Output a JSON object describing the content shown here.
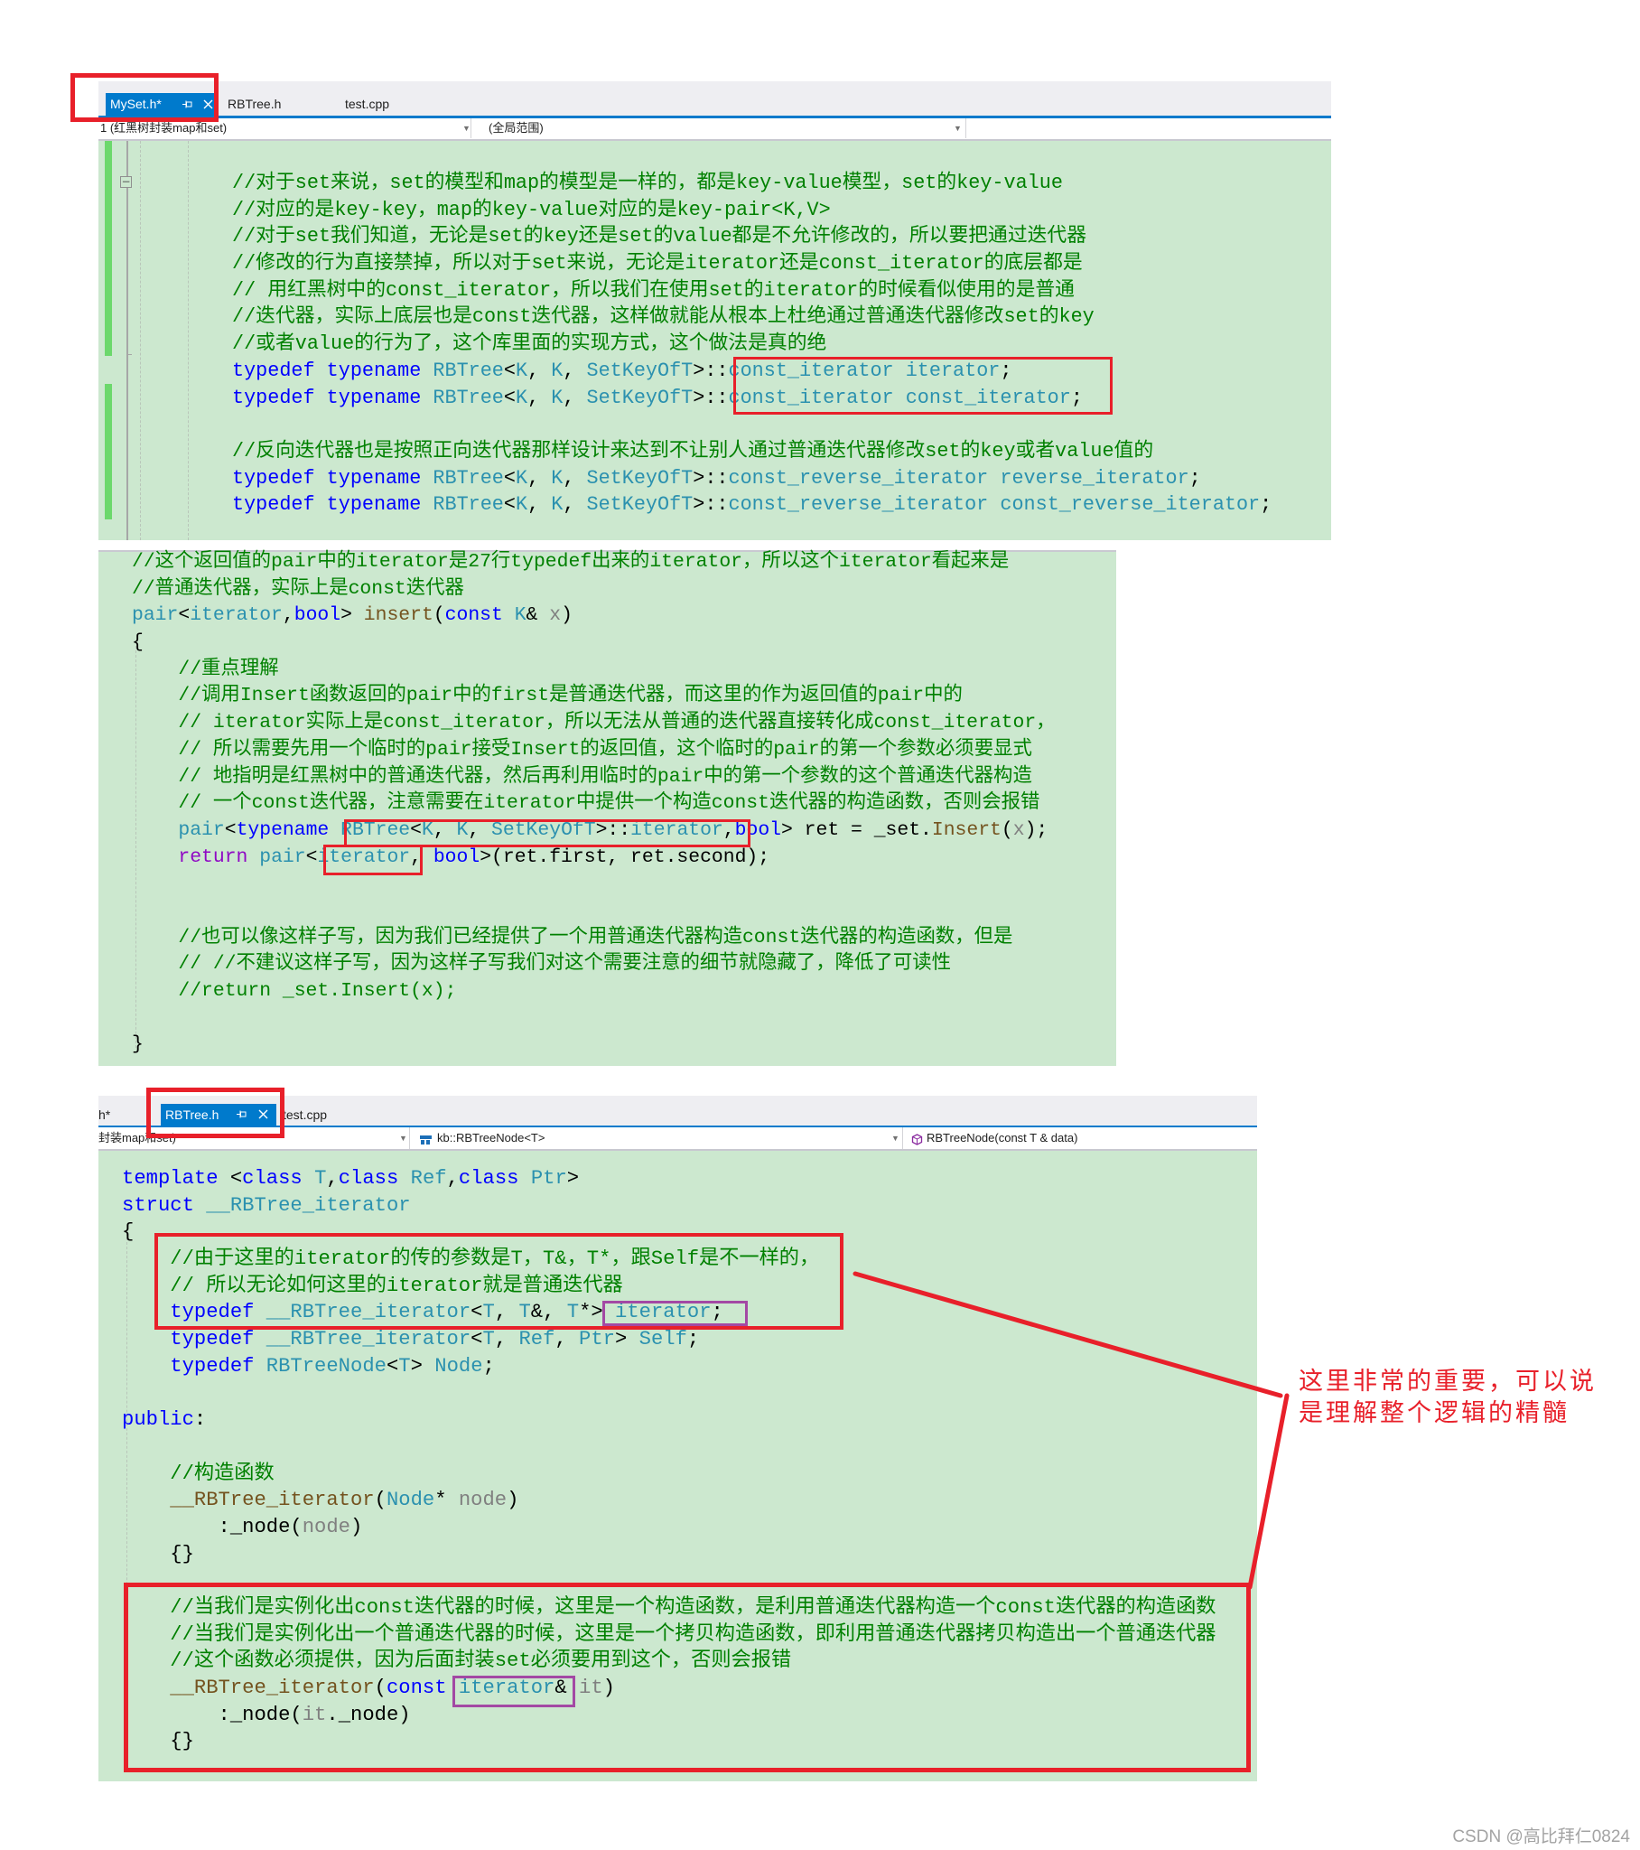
{
  "colors": {
    "tab_active": "#007acc",
    "highlight_red": "#e8202a",
    "highlight_purple": "#a349a4",
    "code_background": "#cce8cf",
    "change_bar": "#6cd86c",
    "syntax": {
      "cm": "#008000",
      "kw": "#0000ff",
      "ty": "#2b91af",
      "fn": "#74531f",
      "pm": "#808080",
      "ct": "#8f08c4",
      "tx": "#000000"
    }
  },
  "panel1": {
    "tabs": [
      {
        "label": "MySet.h*",
        "active": true
      },
      {
        "label": "RBTree.h"
      },
      {
        "label": "test.cpp"
      }
    ],
    "dropdowns": [
      "1 (红黑树封装map和set)",
      "(全局范围)",
      ""
    ],
    "lines": [
      {
        "indent": 0,
        "tokens": [
          [
            "cm",
            "//对于set来说，set的模型和map的模型是一样的，都是key-value模型，set的key-value"
          ]
        ]
      },
      {
        "indent": 0,
        "tokens": [
          [
            "cm",
            "//对应的是key-key，map的key-value对应的是key-pair<K,V>"
          ]
        ]
      },
      {
        "indent": 0,
        "tokens": [
          [
            "cm",
            "//对于set我们知道，无论是set的key还是set的value都是不允许修改的，所以要把通过迭代器"
          ]
        ]
      },
      {
        "indent": 0,
        "tokens": [
          [
            "cm",
            "//修改的行为直接禁掉，所以对于set来说，无论是iterator还是const_iterator的底层都是"
          ]
        ]
      },
      {
        "indent": 0,
        "tokens": [
          [
            "cm",
            "// 用红黑树中的const_iterator，所以我们在使用set的iterator的时候看似使用的是普通"
          ]
        ]
      },
      {
        "indent": 0,
        "tokens": [
          [
            "cm",
            "//迭代器，实际上底层也是const迭代器，这样做就能从根本上杜绝通过普通迭代器修改set的key"
          ]
        ]
      },
      {
        "indent": 0,
        "tokens": [
          [
            "cm",
            "//或者value的行为了，这个库里面的实现方式，这个做法是真的绝"
          ]
        ]
      },
      {
        "indent": 0,
        "tokens": [
          [
            "kw",
            "typedef"
          ],
          [
            "tx",
            " "
          ],
          [
            "kw",
            "typename"
          ],
          [
            "tx",
            " "
          ],
          [
            "ty",
            "RBTree"
          ],
          [
            "tx",
            "<"
          ],
          [
            "ty",
            "K"
          ],
          [
            "tx",
            ", "
          ],
          [
            "ty",
            "K"
          ],
          [
            "tx",
            ", "
          ],
          [
            "ty",
            "SetKeyOfT"
          ],
          [
            "tx",
            ">::"
          ],
          [
            "ty",
            "const_iterator"
          ],
          [
            "tx",
            " "
          ],
          [
            "ty",
            "iterator"
          ],
          [
            "tx",
            ";"
          ]
        ]
      },
      {
        "indent": 0,
        "tokens": [
          [
            "kw",
            "typedef"
          ],
          [
            "tx",
            " "
          ],
          [
            "kw",
            "typename"
          ],
          [
            "tx",
            " "
          ],
          [
            "ty",
            "RBTree"
          ],
          [
            "tx",
            "<"
          ],
          [
            "ty",
            "K"
          ],
          [
            "tx",
            ", "
          ],
          [
            "ty",
            "K"
          ],
          [
            "tx",
            ", "
          ],
          [
            "ty",
            "SetKeyOfT"
          ],
          [
            "tx",
            ">::"
          ],
          [
            "ty",
            "const_iterator"
          ],
          [
            "tx",
            " "
          ],
          [
            "ty",
            "const_iterator"
          ],
          [
            "tx",
            ";"
          ]
        ]
      },
      {
        "indent": 0,
        "tokens": []
      },
      {
        "indent": 0,
        "tokens": [
          [
            "cm",
            "//反向迭代器也是按照正向迭代器那样设计来达到不让别人通过普通迭代器修改set的key或者value值的"
          ]
        ]
      },
      {
        "indent": 0,
        "tokens": [
          [
            "kw",
            "typedef"
          ],
          [
            "tx",
            " "
          ],
          [
            "kw",
            "typename"
          ],
          [
            "tx",
            " "
          ],
          [
            "ty",
            "RBTree"
          ],
          [
            "tx",
            "<"
          ],
          [
            "ty",
            "K"
          ],
          [
            "tx",
            ", "
          ],
          [
            "ty",
            "K"
          ],
          [
            "tx",
            ", "
          ],
          [
            "ty",
            "SetKeyOfT"
          ],
          [
            "tx",
            ">::"
          ],
          [
            "ty",
            "const_reverse_iterator"
          ],
          [
            "tx",
            " "
          ],
          [
            "ty",
            "reverse_iterator"
          ],
          [
            "tx",
            ";"
          ]
        ]
      },
      {
        "indent": 0,
        "tokens": [
          [
            "kw",
            "typedef"
          ],
          [
            "tx",
            " "
          ],
          [
            "kw",
            "typename"
          ],
          [
            "tx",
            " "
          ],
          [
            "ty",
            "RBTree"
          ],
          [
            "tx",
            "<"
          ],
          [
            "ty",
            "K"
          ],
          [
            "tx",
            ", "
          ],
          [
            "ty",
            "K"
          ],
          [
            "tx",
            ", "
          ],
          [
            "ty",
            "SetKeyOfT"
          ],
          [
            "tx",
            ">::"
          ],
          [
            "ty",
            "const_reverse_iterator"
          ],
          [
            "tx",
            " "
          ],
          [
            "ty",
            "const_reverse_iterator"
          ],
          [
            "tx",
            ";"
          ]
        ]
      }
    ]
  },
  "panel2": {
    "lines": [
      {
        "indent": 0,
        "tokens": [
          [
            "cm",
            "//这个返回值的pair中的iterator是27行typedef出来的iterator，所以这个iterator看起来是"
          ]
        ]
      },
      {
        "indent": 0,
        "tokens": [
          [
            "cm",
            "//普通迭代器，实际上是const迭代器"
          ]
        ]
      },
      {
        "indent": 0,
        "tokens": [
          [
            "ty",
            "pair"
          ],
          [
            "tx",
            "<"
          ],
          [
            "ty",
            "iterator"
          ],
          [
            "tx",
            ","
          ],
          [
            "kw",
            "bool"
          ],
          [
            "tx",
            "> "
          ],
          [
            "fn",
            "insert"
          ],
          [
            "tx",
            "("
          ],
          [
            "kw",
            "const"
          ],
          [
            "tx",
            " "
          ],
          [
            "ty",
            "K"
          ],
          [
            "tx",
            "& "
          ],
          [
            "pm",
            "x"
          ],
          [
            "tx",
            ")"
          ]
        ]
      },
      {
        "indent": 0,
        "tokens": [
          [
            "tx",
            "{"
          ]
        ]
      },
      {
        "indent": 4,
        "tokens": [
          [
            "cm",
            "//重点理解"
          ]
        ]
      },
      {
        "indent": 4,
        "tokens": [
          [
            "cm",
            "//调用Insert函数返回的pair中的first是普通迭代器，而这里的作为返回值的pair中的"
          ]
        ]
      },
      {
        "indent": 4,
        "tokens": [
          [
            "cm",
            "// iterator实际上是const_iterator，所以无法从普通的迭代器直接转化成const_iterator，"
          ]
        ]
      },
      {
        "indent": 4,
        "tokens": [
          [
            "cm",
            "// 所以需要先用一个临时的pair接受Insert的返回值，这个临时的pair的第一个参数必须要显式"
          ]
        ]
      },
      {
        "indent": 4,
        "tokens": [
          [
            "cm",
            "// 地指明是红黑树中的普通迭代器，然后再利用临时的pair中的第一个参数的这个普通迭代器构造"
          ]
        ]
      },
      {
        "indent": 4,
        "tokens": [
          [
            "cm",
            "// 一个const迭代器，注意需要在iterator中提供一个构造const迭代器的构造函数，否则会报错"
          ]
        ]
      },
      {
        "indent": 4,
        "tokens": [
          [
            "ty",
            "pair"
          ],
          [
            "tx",
            "<"
          ],
          [
            "kw",
            "typename"
          ],
          [
            "tx",
            " "
          ],
          [
            "ty",
            "RBTree"
          ],
          [
            "tx",
            "<"
          ],
          [
            "ty",
            "K"
          ],
          [
            "tx",
            ", "
          ],
          [
            "ty",
            "K"
          ],
          [
            "tx",
            ", "
          ],
          [
            "ty",
            "SetKeyOfT"
          ],
          [
            "tx",
            ">::"
          ],
          [
            "ty",
            "iterator"
          ],
          [
            "tx",
            ","
          ],
          [
            "kw",
            "bool"
          ],
          [
            "tx",
            "> ret = _set."
          ],
          [
            "fn",
            "Insert"
          ],
          [
            "tx",
            "("
          ],
          [
            "pm",
            "x"
          ],
          [
            "tx",
            ");"
          ]
        ]
      },
      {
        "indent": 4,
        "tokens": [
          [
            "ct",
            "return"
          ],
          [
            "tx",
            " "
          ],
          [
            "ty",
            "pair"
          ],
          [
            "tx",
            "<"
          ],
          [
            "ty",
            "iterator"
          ],
          [
            "tx",
            ", "
          ],
          [
            "kw",
            "bool"
          ],
          [
            "tx",
            ">(ret.first, ret.second);"
          ]
        ]
      },
      {
        "indent": 0,
        "tokens": []
      },
      {
        "indent": 0,
        "tokens": []
      },
      {
        "indent": 4,
        "tokens": [
          [
            "cm",
            "//也可以像这样子写，因为我们已经提供了一个用普通迭代器构造const迭代器的构造函数，但是"
          ]
        ]
      },
      {
        "indent": 4,
        "tokens": [
          [
            "cm",
            "// //不建议这样子写，因为这样子写我们对这个需要注意的细节就隐藏了，降低了可读性"
          ]
        ]
      },
      {
        "indent": 4,
        "tokens": [
          [
            "cm",
            "//return _set.Insert(x);"
          ]
        ]
      },
      {
        "indent": 0,
        "tokens": []
      },
      {
        "indent": 0,
        "tokens": [
          [
            "tx",
            "}"
          ]
        ]
      }
    ]
  },
  "panel3": {
    "tabs": [
      {
        "label": "h*"
      },
      {
        "label": "RBTree.h",
        "active": true
      },
      {
        "label": "test.cpp"
      }
    ],
    "dropdowns": [
      "封装map和set)",
      "kb::RBTreeNode<T>",
      "RBTreeNode(const T & data)"
    ],
    "lines": [
      {
        "indent": 0,
        "tokens": [
          [
            "kw",
            "template"
          ],
          [
            "tx",
            " <"
          ],
          [
            "kw",
            "class"
          ],
          [
            "tx",
            " "
          ],
          [
            "ty",
            "T"
          ],
          [
            "tx",
            ","
          ],
          [
            "kw",
            "class"
          ],
          [
            "tx",
            " "
          ],
          [
            "ty",
            "Ref"
          ],
          [
            "tx",
            ","
          ],
          [
            "kw",
            "class"
          ],
          [
            "tx",
            " "
          ],
          [
            "ty",
            "Ptr"
          ],
          [
            "tx",
            ">"
          ]
        ]
      },
      {
        "indent": 0,
        "tokens": [
          [
            "kw",
            "struct"
          ],
          [
            "tx",
            " "
          ],
          [
            "ty",
            "__RBTree_iterator"
          ]
        ]
      },
      {
        "indent": 0,
        "tokens": [
          [
            "tx",
            "{"
          ]
        ]
      },
      {
        "indent": 4,
        "tokens": [
          [
            "cm",
            "//由于这里的iterator的传的参数是T，T&，T*，跟Self是不一样的，"
          ]
        ]
      },
      {
        "indent": 4,
        "tokens": [
          [
            "cm",
            "// 所以无论如何这里的iterator就是普通迭代器"
          ]
        ]
      },
      {
        "indent": 4,
        "tokens": [
          [
            "kw",
            "typedef"
          ],
          [
            "tx",
            " "
          ],
          [
            "ty",
            "__RBTree_iterator"
          ],
          [
            "tx",
            "<"
          ],
          [
            "ty",
            "T"
          ],
          [
            "tx",
            ", "
          ],
          [
            "ty",
            "T"
          ],
          [
            "tx",
            "&, "
          ],
          [
            "ty",
            "T"
          ],
          [
            "tx",
            "*> "
          ],
          [
            "ty",
            "iterator"
          ],
          [
            "tx",
            ";"
          ]
        ]
      },
      {
        "indent": 4,
        "tokens": [
          [
            "kw",
            "typedef"
          ],
          [
            "tx",
            " "
          ],
          [
            "ty",
            "__RBTree_iterator"
          ],
          [
            "tx",
            "<"
          ],
          [
            "ty",
            "T"
          ],
          [
            "tx",
            ", "
          ],
          [
            "ty",
            "Ref"
          ],
          [
            "tx",
            ", "
          ],
          [
            "ty",
            "Ptr"
          ],
          [
            "tx",
            "> "
          ],
          [
            "ty",
            "Self"
          ],
          [
            "tx",
            ";"
          ]
        ]
      },
      {
        "indent": 4,
        "tokens": [
          [
            "kw",
            "typedef"
          ],
          [
            "tx",
            " "
          ],
          [
            "ty",
            "RBTreeNode"
          ],
          [
            "tx",
            "<"
          ],
          [
            "ty",
            "T"
          ],
          [
            "tx",
            "> "
          ],
          [
            "ty",
            "Node"
          ],
          [
            "tx",
            ";"
          ]
        ]
      },
      {
        "indent": 0,
        "tokens": []
      },
      {
        "indent": 0,
        "tokens": [
          [
            "kw",
            "public"
          ],
          [
            "tx",
            ":"
          ]
        ]
      },
      {
        "indent": 0,
        "tokens": []
      },
      {
        "indent": 4,
        "tokens": [
          [
            "cm",
            "//构造函数"
          ]
        ]
      },
      {
        "indent": 4,
        "tokens": [
          [
            "fn",
            "__RBTree_iterator"
          ],
          [
            "tx",
            "("
          ],
          [
            "ty",
            "Node"
          ],
          [
            "tx",
            "* "
          ],
          [
            "pm",
            "node"
          ],
          [
            "tx",
            ")"
          ]
        ]
      },
      {
        "indent": 8,
        "tokens": [
          [
            "tx",
            ":_node("
          ],
          [
            "pm",
            "node"
          ],
          [
            "tx",
            ")"
          ]
        ]
      },
      {
        "indent": 4,
        "tokens": [
          [
            "tx",
            "{}"
          ]
        ]
      },
      {
        "indent": 0,
        "tokens": []
      },
      {
        "indent": 4,
        "tokens": [
          [
            "cm",
            "//当我们是实例化出const迭代器的时候，这里是一个构造函数，是利用普通迭代器构造一个const迭代器的构造函数"
          ]
        ]
      },
      {
        "indent": 4,
        "tokens": [
          [
            "cm",
            "//当我们是实例化出一个普通迭代器的时候，这里是一个拷贝构造函数，即利用普通迭代器拷贝构造出一个普通迭代器"
          ]
        ]
      },
      {
        "indent": 4,
        "tokens": [
          [
            "cm",
            "//这个函数必须提供，因为后面封装set必须要用到这个，否则会报错"
          ]
        ]
      },
      {
        "indent": 4,
        "tokens": [
          [
            "fn",
            "__RBTree_iterator"
          ],
          [
            "tx",
            "("
          ],
          [
            "kw",
            "const"
          ],
          [
            "tx",
            " "
          ],
          [
            "ty",
            "iterator"
          ],
          [
            "tx",
            "& "
          ],
          [
            "pm",
            "it"
          ],
          [
            "tx",
            ")"
          ]
        ]
      },
      {
        "indent": 8,
        "tokens": [
          [
            "tx",
            ":_node("
          ],
          [
            "pm",
            "it"
          ],
          [
            "tx",
            "._node)"
          ]
        ]
      },
      {
        "indent": 4,
        "tokens": [
          [
            "tx",
            "{}"
          ]
        ]
      }
    ]
  },
  "annotation": {
    "lines": [
      "这里非常的重要，可以说",
      "是理解整个逻辑的精髓"
    ]
  },
  "watermark": "CSDN @高比拜仁0824"
}
